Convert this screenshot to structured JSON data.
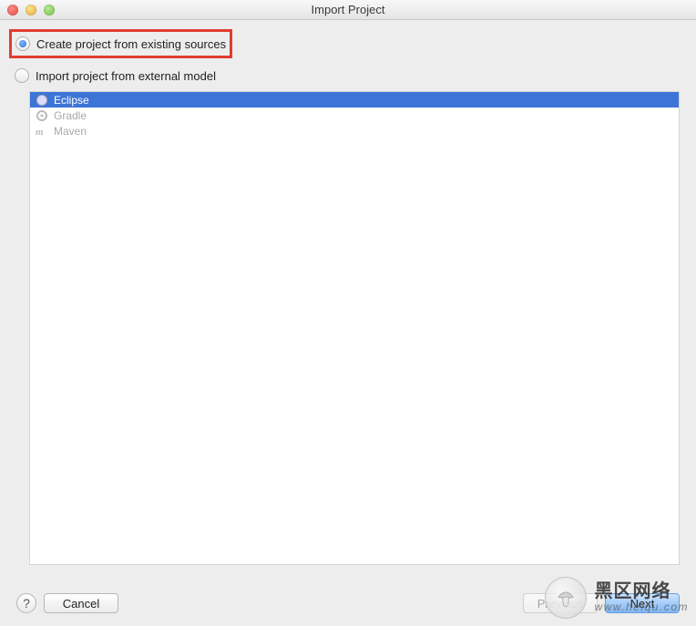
{
  "window": {
    "title": "Import Project"
  },
  "options": {
    "create_from_existing": {
      "label": "Create project from existing sources",
      "selected": true,
      "highlighted": true
    },
    "import_external": {
      "label": "Import project from external model",
      "selected": false
    }
  },
  "external_models": [
    {
      "name": "Eclipse",
      "icon": "eclipse-icon",
      "selected": true
    },
    {
      "name": "Gradle",
      "icon": "gradle-icon",
      "selected": false
    },
    {
      "name": "Maven",
      "icon": "maven-icon",
      "selected": false
    }
  ],
  "buttons": {
    "help": "?",
    "cancel": "Cancel",
    "previous": "Previous",
    "next": "Next"
  },
  "watermark": {
    "title": "黑区网络",
    "sub": "www.heiqu.com"
  }
}
